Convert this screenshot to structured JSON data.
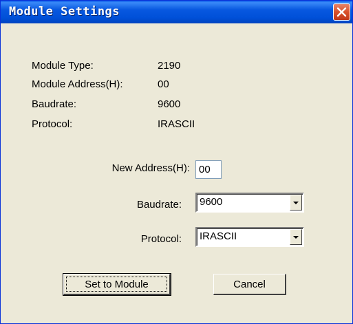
{
  "window": {
    "title": "Module Settings"
  },
  "info": {
    "module_type_label": "Module Type:",
    "module_type_value": "2190",
    "module_address_label": "Module Address(H):",
    "module_address_value": "00",
    "baudrate_label": "Baudrate:",
    "baudrate_value": "9600",
    "protocol_label": "Protocol:",
    "protocol_value": "IRASCII"
  },
  "form": {
    "new_address_label": "New Address(H):",
    "new_address_value": "00",
    "baudrate_label": "Baudrate:",
    "baudrate_selected": "9600",
    "protocol_label": "Protocol:",
    "protocol_selected": "IRASCII"
  },
  "buttons": {
    "set_to_module": "Set to Module",
    "cancel": "Cancel"
  },
  "colors": {
    "title_bar": "#0054e3",
    "close_button": "#d9512c",
    "dialog_bg": "#ece9d8"
  },
  "icons": {
    "close": "close-icon",
    "dropdown": "chevron-down-icon"
  }
}
